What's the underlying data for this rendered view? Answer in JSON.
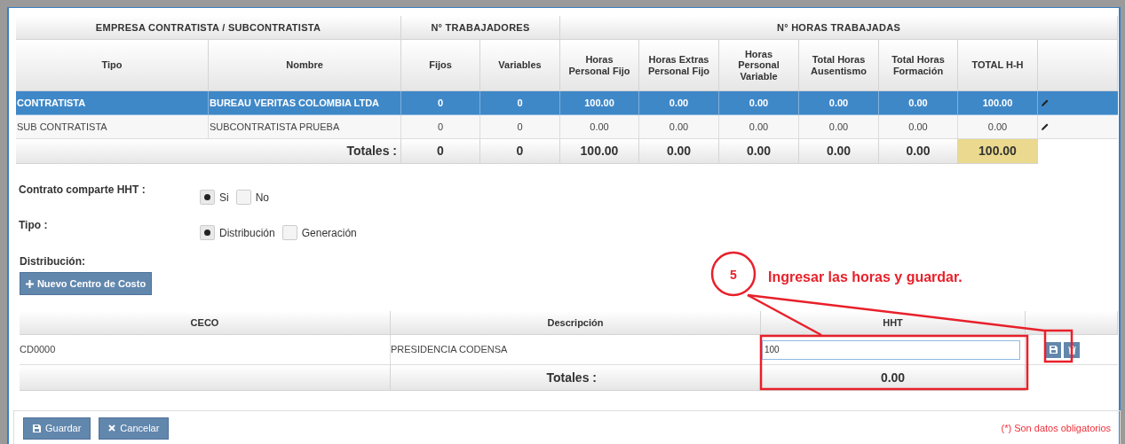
{
  "main_table": {
    "groups": [
      "EMPRESA CONTRATISTA / SUBCONTRATISTA",
      "N° TRABAJADORES",
      "N° HORAS TRABAJADAS"
    ],
    "columns": [
      "Tipo",
      "Nombre",
      "Fijos",
      "Variables",
      "Horas\nPersonal Fijo",
      "Horas Extras\nPersonal Fijo",
      "Horas\nPersonal\nVariable",
      "Total Horas\nAusentismo",
      "Total Horas\nFormación",
      "TOTAL H-H"
    ],
    "rows": [
      {
        "cells": [
          "CONTRATISTA",
          "BUREAU VERITAS COLOMBIA LTDA",
          "0",
          "0",
          "100.00",
          "0.00",
          "0.00",
          "0.00",
          "0.00",
          "100.00"
        ],
        "selected": true
      },
      {
        "cells": [
          "SUB CONTRATISTA",
          "SUBCONTRATISTA PRUEBA",
          "0",
          "0",
          "0.00",
          "0.00",
          "0.00",
          "0.00",
          "0.00",
          "0.00"
        ],
        "selected": false
      }
    ],
    "totals": {
      "label": "Totales :",
      "values": [
        "0",
        "0",
        "100.00",
        "0.00",
        "0.00",
        "0.00",
        "0.00",
        "100.00"
      ]
    }
  },
  "options": [
    {
      "label": "Contrato comparte HHT :",
      "choices": [
        {
          "label": "Si",
          "selected": true
        },
        {
          "label": "No",
          "selected": false
        }
      ]
    },
    {
      "label": "Tipo :",
      "choices": [
        {
          "label": "Distribución",
          "selected": true
        },
        {
          "label": "Generación",
          "selected": false
        }
      ]
    }
  ],
  "distribution": {
    "label": "Distribución:",
    "new_button": "Nuevo Centro de Costo",
    "columns": [
      "CECO",
      "Descripción",
      "HHT"
    ],
    "rows": [
      {
        "ceco": "CD0000",
        "descripcion": "PRESIDENCIA CODENSA",
        "hht": "100"
      }
    ],
    "totals": {
      "label": "Totales :",
      "value": "0.00"
    }
  },
  "annotation": {
    "step": "5",
    "text": "Ingresar las horas y guardar."
  },
  "footer": {
    "buttons": [
      {
        "kind": "save",
        "label": "Guardar"
      },
      {
        "kind": "cancel",
        "label": "Cancelar"
      }
    ],
    "note": "(*) Son datos obligatorios"
  }
}
